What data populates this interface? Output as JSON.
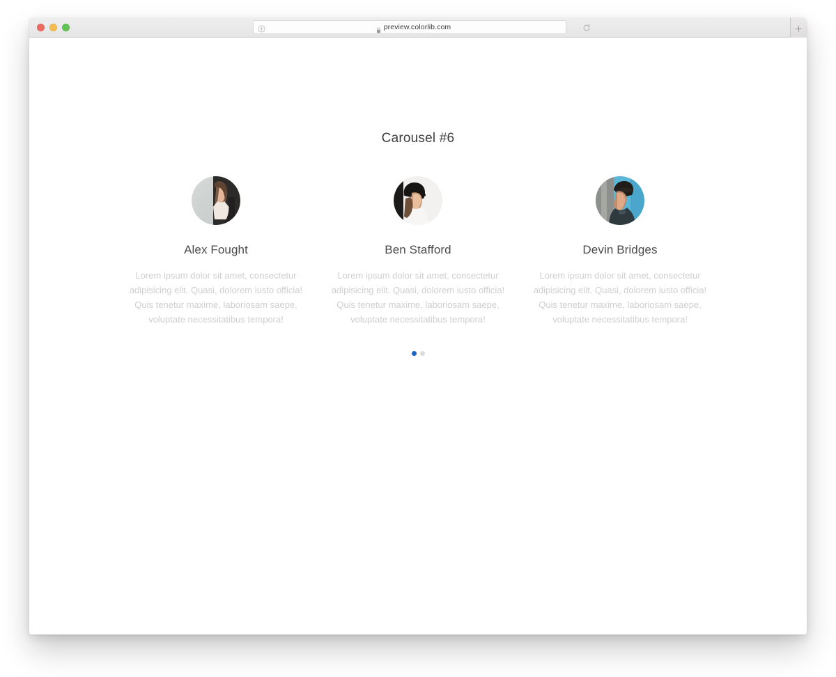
{
  "browser": {
    "traffic_lights": [
      {
        "name": "close",
        "color": "#ec6a5f"
      },
      {
        "name": "minimize",
        "color": "#f4bd4f"
      },
      {
        "name": "maximize",
        "color": "#61c455"
      }
    ],
    "url": "preview.colorlib.com",
    "url_left_icon": "compass-icon",
    "lock_icon": "lock-icon",
    "reload_icon": "reload-icon",
    "new_tab_icon": "plus-icon"
  },
  "page": {
    "title": "Carousel #6",
    "slides": [
      {
        "name": "Alex Fought",
        "text": "Lorem ipsum dolor sit amet, consectetur adipisicing elit. Quasi, dolorem iusto officia! Quis tenetur maxime, laboriosam saepe, voluptate necessitatibus tempora!",
        "avatar_alt": "woman-with-long-brown-hair-avatar"
      },
      {
        "name": "Ben Stafford",
        "text": "Lorem ipsum dolor sit amet, consectetur adipisicing elit. Quasi, dolorem iusto officia! Quis tenetur maxime, laboriosam saepe, voluptate necessitatibus tempora!",
        "avatar_alt": "person-wearing-dark-hat-avatar"
      },
      {
        "name": "Devin Bridges",
        "text": "Lorem ipsum dolor sit amet, consectetur adipisicing elit. Quasi, dolorem iusto officia! Quis tenetur maxime, laboriosam saepe, voluptate necessitatibus tempora!",
        "avatar_alt": "young-man-blue-background-avatar"
      }
    ],
    "pagination": {
      "count": 2,
      "active_index": 0,
      "active_color": "#1d64c4",
      "inactive_color": "#dcdcdc"
    }
  }
}
